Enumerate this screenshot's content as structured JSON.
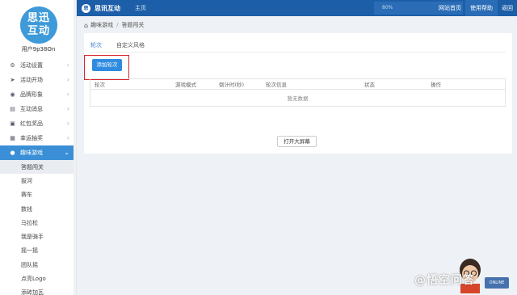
{
  "sidebar": {
    "logo_line1": "思迅",
    "logo_line2": "互动",
    "username": "用户9p38On",
    "items": [
      {
        "label": "活动设置",
        "icon": "gear-icon",
        "glyph": "⚙"
      },
      {
        "label": "活动开场",
        "icon": "send-icon",
        "glyph": "➤"
      },
      {
        "label": "品牌形象",
        "icon": "palette-icon",
        "glyph": "◉"
      },
      {
        "label": "互动消息",
        "icon": "chat-icon",
        "glyph": "▤"
      },
      {
        "label": "红包奖品",
        "icon": "gift-icon",
        "glyph": "▣"
      },
      {
        "label": "幸运抽奖",
        "icon": "lottery-icon",
        "glyph": "▦"
      },
      {
        "label": "趣味游戏",
        "icon": "game-icon",
        "glyph": "●"
      }
    ],
    "sub_items": [
      "答题闯关",
      "拔河",
      "赛车",
      "数钱",
      "马拉松",
      "我是骑手",
      "摇一摇",
      "团队摇",
      "点亮Logo",
      "添砖加瓦"
    ]
  },
  "topbar": {
    "brand": "思讯互动",
    "brand_mark": "思",
    "home": "主页",
    "search_value": "80%",
    "links": [
      "网站首页",
      "使用帮助",
      "返回"
    ]
  },
  "breadcrumb": {
    "home_icon": "home-icon",
    "level1": "趣味游戏",
    "sep": "/",
    "level2": "答题闯关"
  },
  "panel": {
    "tabs": [
      "轮次",
      "自定义风格"
    ],
    "add_button": "添加轮次",
    "columns": [
      "轮次",
      "游戏模式",
      "倒计时(秒)",
      "轮次信息",
      "状态",
      "操作"
    ],
    "empty_text": "暂无数据",
    "open_screen_button": "打开大屏幕"
  },
  "watermark": {
    "text": "@悟空问答",
    "badge": "ONLINE"
  },
  "colors": {
    "topbar": "#1c5ea8",
    "accent": "#2f8be0",
    "active_nav": "#3a8fd6",
    "highlight": "#d8232a"
  }
}
